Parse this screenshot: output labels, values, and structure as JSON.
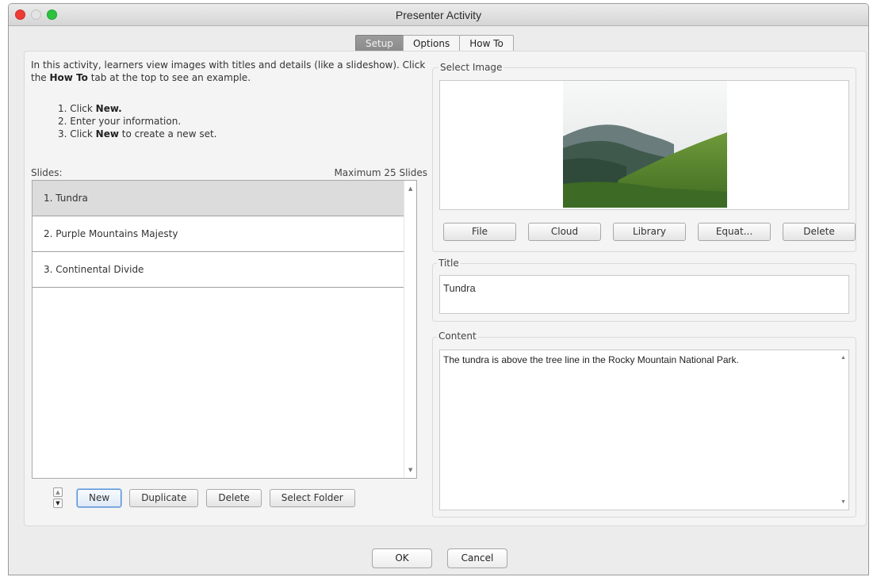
{
  "window": {
    "title": "Presenter Activity"
  },
  "tabs": [
    {
      "label": "Setup",
      "active": true
    },
    {
      "label": "Options",
      "active": false
    },
    {
      "label": "How To",
      "active": false
    }
  ],
  "intro": {
    "line1_pre": "In this activity, learners view images with titles and details (like a slideshow). Click the ",
    "bold": "How To",
    "line1_post": " tab at the top to see an example."
  },
  "steps": [
    {
      "pre": "1. Click ",
      "bold": "New.",
      "post": ""
    },
    {
      "pre": "2. Enter your information.",
      "bold": "",
      "post": ""
    },
    {
      "pre": "3. Click ",
      "bold": "New",
      "post": " to create a new set."
    }
  ],
  "slides": {
    "label": "Slides:",
    "max_label": "Maximum 25 Slides",
    "items": [
      {
        "label": "1.  Tundra",
        "selected": true
      },
      {
        "label": "2.  Purple Mountains Majesty",
        "selected": false
      },
      {
        "label": "3.  Continental Divide",
        "selected": false
      }
    ]
  },
  "slide_actions": {
    "new": "New",
    "duplicate": "Duplicate",
    "delete": "Delete",
    "select_folder": "Select Folder"
  },
  "select_image": {
    "label": "Select Image",
    "buttons": {
      "file": "File",
      "cloud": "Cloud",
      "library": "Library",
      "equation": "Equat...",
      "delete": "Delete"
    }
  },
  "title_field": {
    "label": "Title",
    "value": "Tundra"
  },
  "content_field": {
    "label": "Content",
    "value": "The tundra is above the tree line in the Rocky Mountain National Park."
  },
  "footer": {
    "ok": "OK",
    "cancel": "Cancel"
  },
  "colors": {
    "close": "#ee3b33",
    "minimize": "#e3e3e3",
    "maximize": "#2ac33e",
    "active_tab": "#8f8f8f",
    "default_button_border": "#5a8fd0"
  }
}
